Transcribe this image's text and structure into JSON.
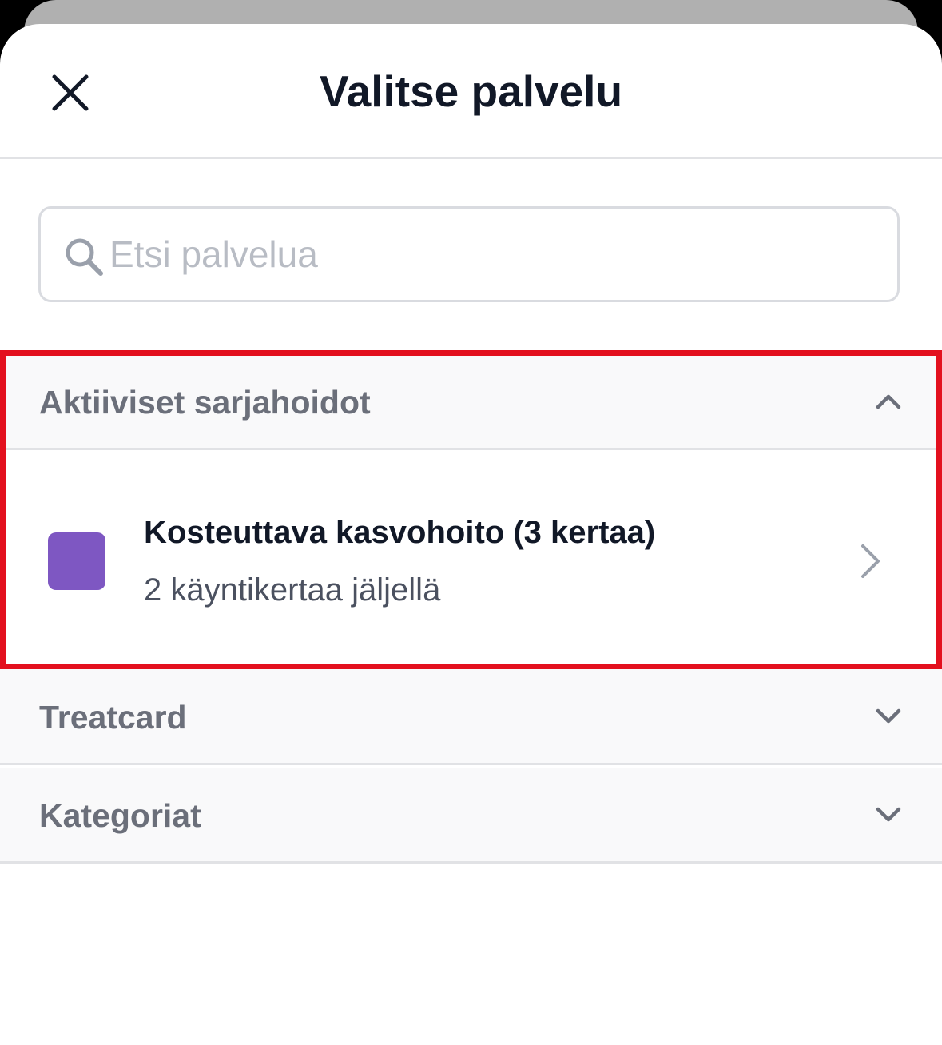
{
  "header": {
    "title": "Valitse palvelu",
    "close_icon": "close-icon"
  },
  "search": {
    "placeholder": "Etsi palvelua",
    "value": "",
    "icon": "search-icon"
  },
  "sections": {
    "active": {
      "label": "Aktiiviset sarjahoidot",
      "expanded": true,
      "icon": "chevron-up-icon",
      "items": [
        {
          "name": "Kosteuttava kasvohoito (3 kertaa)",
          "subtitle": "2 käyntikertaa jäljellä",
          "color": "#7e57c2",
          "icon": "chevron-right-icon"
        }
      ]
    },
    "treatcard": {
      "label": "Treatcard",
      "expanded": false,
      "icon": "chevron-down-icon"
    },
    "categories": {
      "label": "Kategoriat",
      "expanded": false,
      "icon": "chevron-down-icon"
    }
  },
  "colors": {
    "highlight": "#e3101e",
    "title_text": "#111827",
    "section_text": "#6b6f7a",
    "section_bg": "#f9f9fa"
  }
}
